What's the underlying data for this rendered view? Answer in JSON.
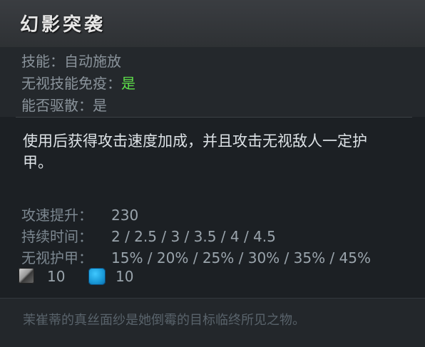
{
  "ability": {
    "title": "幻影突袭"
  },
  "properties": {
    "ability_label": "技能：",
    "ability_value": "自动施放",
    "bkb_label": "无视技能免疫：",
    "bkb_value": "是",
    "dispel_label": "能否驱散：",
    "dispel_value": "是"
  },
  "description": "使用后获得攻击速度加成，并且攻击无视敌人一定护甲。",
  "stats": [
    {
      "label": "攻速提升：",
      "value": "230"
    },
    {
      "label": "持续时间：",
      "value": "2 / 2.5 / 3 / 3.5 / 4 / 4.5"
    },
    {
      "label": "无视护甲：",
      "value": "15% / 20% / 25% / 30% / 35% / 45%"
    }
  ],
  "costs": {
    "cooldown_icon": "cooldown-icon",
    "cooldown": "10",
    "mana_icon": "mana-icon",
    "mana": "10"
  },
  "lore": "茉崔蒂的真丝面纱是她倒霉的目标临终所见之物。",
  "colors": {
    "green_yes": "#5ee04a",
    "mana_blue": "#1a9ad8"
  }
}
